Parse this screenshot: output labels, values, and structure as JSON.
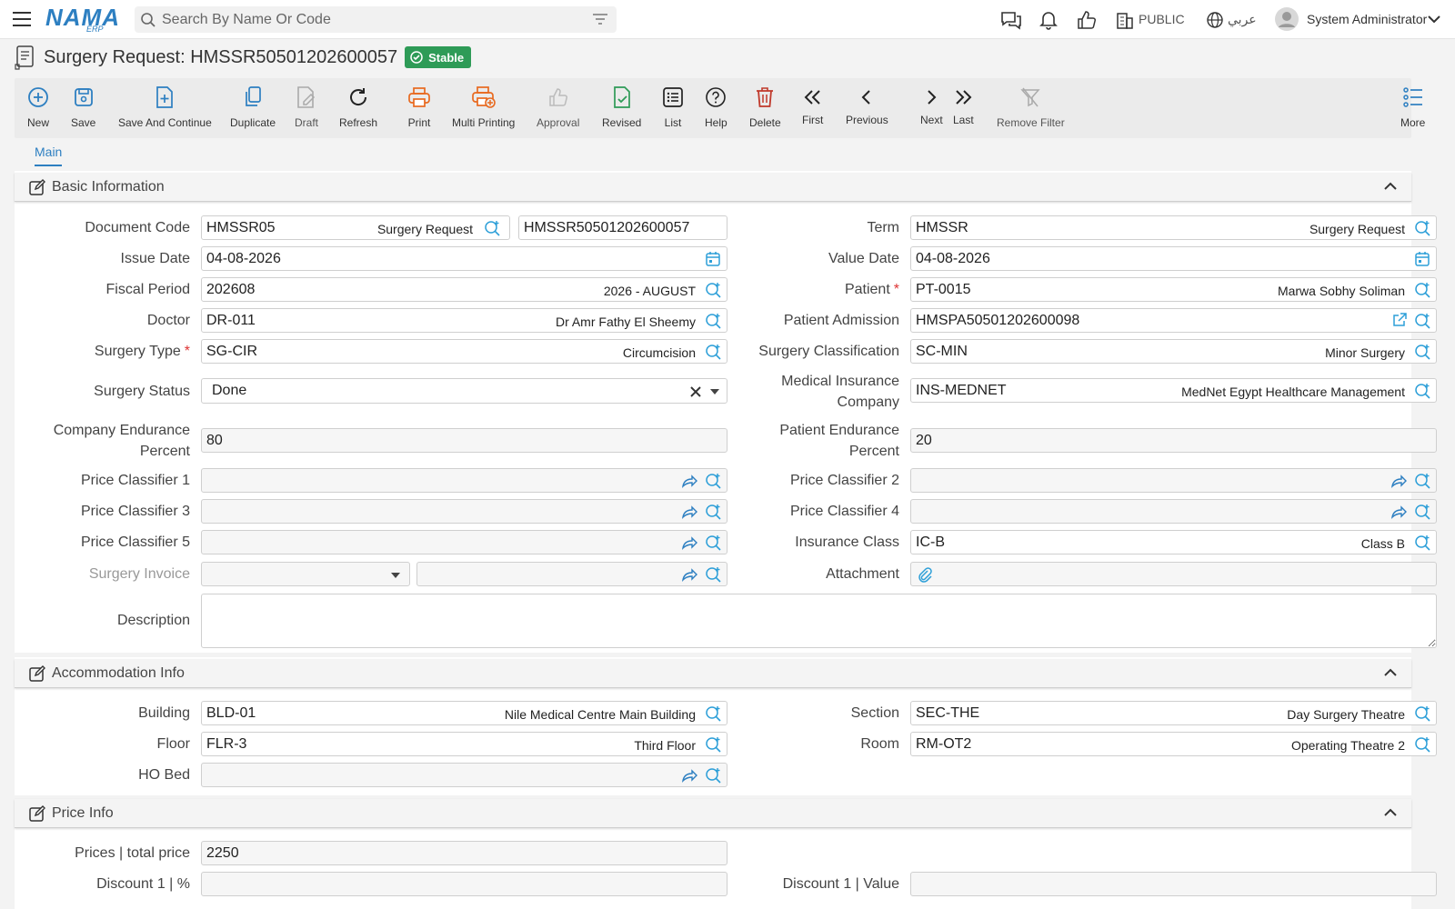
{
  "header": {
    "search_placeholder": "Search By Name Or Code",
    "logo": "NAMA",
    "logo_sub": "ERP",
    "public_label": "PUBLIC",
    "language_label": "عربي",
    "user_name": "System Administrator"
  },
  "page": {
    "title": "Surgery Request: HMSSR50501202600057",
    "status": "Stable"
  },
  "toolbar": {
    "new": "New",
    "save": "Save",
    "save_continue": "Save And Continue",
    "duplicate": "Duplicate",
    "draft": "Draft",
    "refresh": "Refresh",
    "print": "Print",
    "multi_printing": "Multi Printing",
    "approval": "Approval",
    "revised": "Revised",
    "list": "List",
    "help": "Help",
    "delete": "Delete",
    "first": "First",
    "previous": "Previous",
    "next": "Next",
    "last": "Last",
    "remove_filter": "Remove Filter",
    "more": "More"
  },
  "tabs": {
    "main": "Main"
  },
  "basic": {
    "section_title": "Basic Information",
    "document_code_label": "Document Code",
    "document_code": "HMSSR05",
    "document_code_desc": "Surgery Request",
    "document_number": "HMSSR50501202600057",
    "term_label": "Term",
    "term": "HMSSR",
    "term_desc": "Surgery Request",
    "issue_date_label": "Issue Date",
    "issue_date": "04-08-2026",
    "value_date_label": "Value Date",
    "value_date": "04-08-2026",
    "fiscal_period_label": "Fiscal Period",
    "fiscal_period": "202608",
    "fiscal_period_desc": "2026 - AUGUST",
    "patient_label": "Patient",
    "patient": "PT-0015",
    "patient_desc": "Marwa Sobhy Soliman",
    "doctor_label": "Doctor",
    "doctor": "DR-011",
    "doctor_desc": "Dr Amr Fathy El Sheemy",
    "patient_admission_label": "Patient Admission",
    "patient_admission": "HMSPA50501202600098",
    "surgery_type_label": "Surgery Type",
    "surgery_type": "SG-CIR",
    "surgery_type_desc": "Circumcision",
    "surgery_class_label": "Surgery Classification",
    "surgery_class": "SC-MIN",
    "surgery_class_desc": "Minor Surgery",
    "surgery_status_label": "Surgery Status",
    "surgery_status": "Done",
    "med_ins_label_1": "Medical Insurance",
    "med_ins_label_2": "Company",
    "med_ins": "INS-MEDNET",
    "med_ins_desc": "MedNet Egypt Healthcare Management",
    "company_end_label_1": "Company Endurance",
    "company_end_label_2": "Percent",
    "company_end": "80",
    "patient_end_label_1": "Patient Endurance",
    "patient_end_label_2": "Percent",
    "patient_end": "20",
    "pc1_label": "Price Classifier 1",
    "pc2_label": "Price Classifier 2",
    "pc3_label": "Price Classifier 3",
    "pc4_label": "Price Classifier 4",
    "pc5_label": "Price Classifier 5",
    "ins_class_label": "Insurance Class",
    "ins_class": "IC-B",
    "ins_class_desc": "Class B",
    "surgery_invoice_label": "Surgery Invoice",
    "attachment_label": "Attachment",
    "description_label": "Description"
  },
  "accommodation": {
    "section_title": "Accommodation Info",
    "building_label": "Building",
    "building": "BLD-01",
    "building_desc": "Nile Medical Centre Main Building",
    "section_label": "Section",
    "section": "SEC-THE",
    "section_desc": "Day Surgery Theatre",
    "floor_label": "Floor",
    "floor": "FLR-3",
    "floor_desc": "Third Floor",
    "room_label": "Room",
    "room": "RM-OT2",
    "room_desc": "Operating Theatre 2",
    "ho_bed_label": "HO Bed"
  },
  "price": {
    "section_title": "Price Info",
    "total_price_label": "Prices | total price",
    "total_price": "2250",
    "discount1_pct_label": "Discount 1 | %",
    "discount1_val_label": "Discount 1 | Value"
  },
  "colors": {
    "accent": "#2d7fc1",
    "stable_badge": "#2e9b57",
    "print_orange": "#e8691f",
    "delete_red": "#c0392b",
    "revised_green": "#2e9b57"
  }
}
